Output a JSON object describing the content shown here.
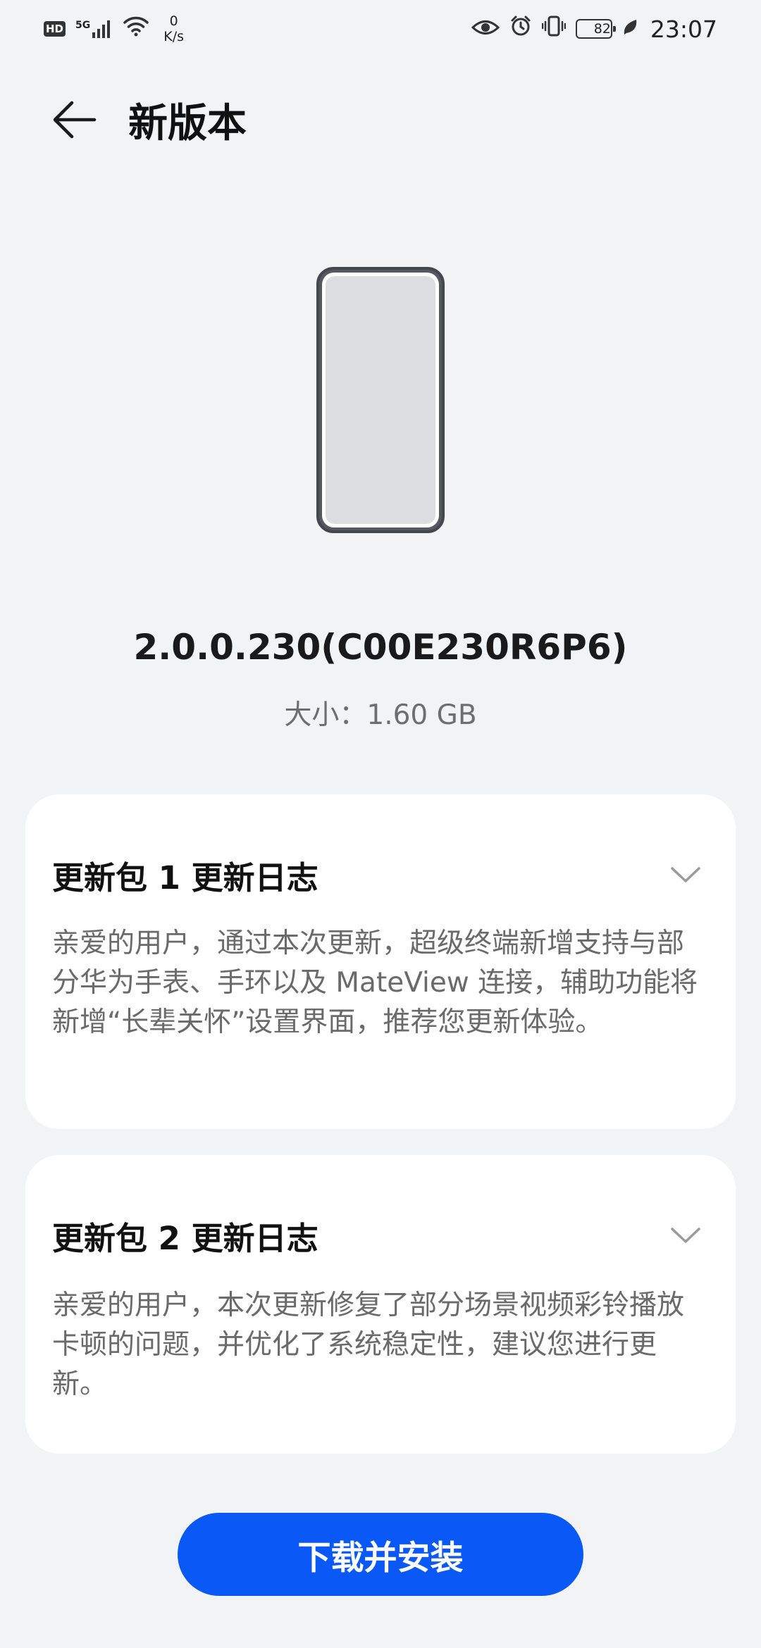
{
  "status_bar": {
    "hd_label": "HD",
    "network_type": "5G",
    "net_speed_value": "0",
    "net_speed_unit": "K/s",
    "battery_level": "82",
    "time": "23:07"
  },
  "header": {
    "title": "新版本"
  },
  "update": {
    "version": "2.0.0.230(C00E230R6P6)",
    "size_label": "大小：1.60 GB"
  },
  "changelogs": [
    {
      "title": "更新包 1 更新日志",
      "body": "亲爱的用户，通过本次更新，超级终端新增支持与部分华为手表、手环以及 MateView 连接，辅助功能将新增“长辈关怀”设置界面，推荐您更新体验。"
    },
    {
      "title": "更新包 2 更新日志",
      "body": "亲爱的用户，本次更新修复了部分场景视频彩铃播放卡顿的问题，并优化了系统稳定性，建议您进行更新。"
    }
  ],
  "actions": {
    "download_install": "下载并安装"
  },
  "colors": {
    "background": "#f1f3f5",
    "card": "#ffffff",
    "accent": "#0a59f7",
    "secondary_text": "#6a6a6a"
  },
  "icons": {
    "back": "arrow-left-icon",
    "expand": "chevron-down-icon",
    "device": "phone-illustration"
  }
}
